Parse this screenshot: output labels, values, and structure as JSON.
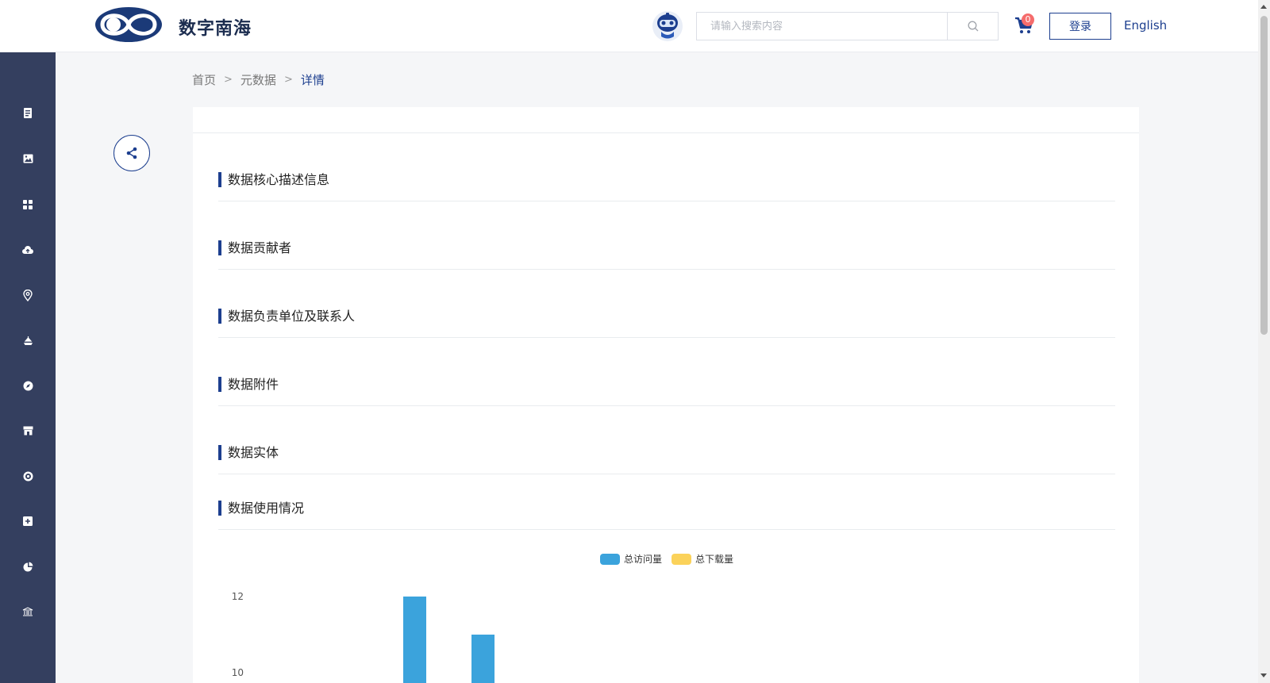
{
  "header": {
    "brand": "数字南海",
    "search_placeholder": "请输入搜索内容",
    "cart_count": "0",
    "login_label": "登录",
    "language_label": "English"
  },
  "sidebar": {
    "items": [
      {
        "icon": "document-icon"
      },
      {
        "icon": "image-icon"
      },
      {
        "icon": "grid-icon"
      },
      {
        "icon": "cloud-upload-icon"
      },
      {
        "icon": "location-pin-icon"
      },
      {
        "icon": "ship-icon"
      },
      {
        "icon": "compass-icon"
      },
      {
        "icon": "store-icon"
      },
      {
        "icon": "target-icon"
      },
      {
        "icon": "plus-square-icon"
      },
      {
        "icon": "pie-chart-icon"
      },
      {
        "icon": "building-icon"
      }
    ]
  },
  "breadcrumb": {
    "home": "首页",
    "metadata": "元数据",
    "current": "详情"
  },
  "sections": [
    {
      "title": "数据核心描述信息"
    },
    {
      "title": "数据贡献者"
    },
    {
      "title": "数据负责单位及联系人"
    },
    {
      "title": "数据附件"
    },
    {
      "title": "数据实体"
    },
    {
      "title": "数据使用情况"
    }
  ],
  "colors": {
    "accent": "#1d3f8f",
    "sidebar_bg": "#343f5f",
    "visits": "#3ba3dc",
    "downloads": "#fbd25a"
  },
  "chart_data": {
    "type": "bar",
    "series": [
      {
        "name": "总访问量",
        "values": [
          12,
          11
        ]
      },
      {
        "name": "总下载量",
        "values": []
      }
    ],
    "y_ticks": [
      "12",
      "10"
    ],
    "ylim_visible": [
      10,
      12
    ],
    "legend_position": "top-center"
  }
}
